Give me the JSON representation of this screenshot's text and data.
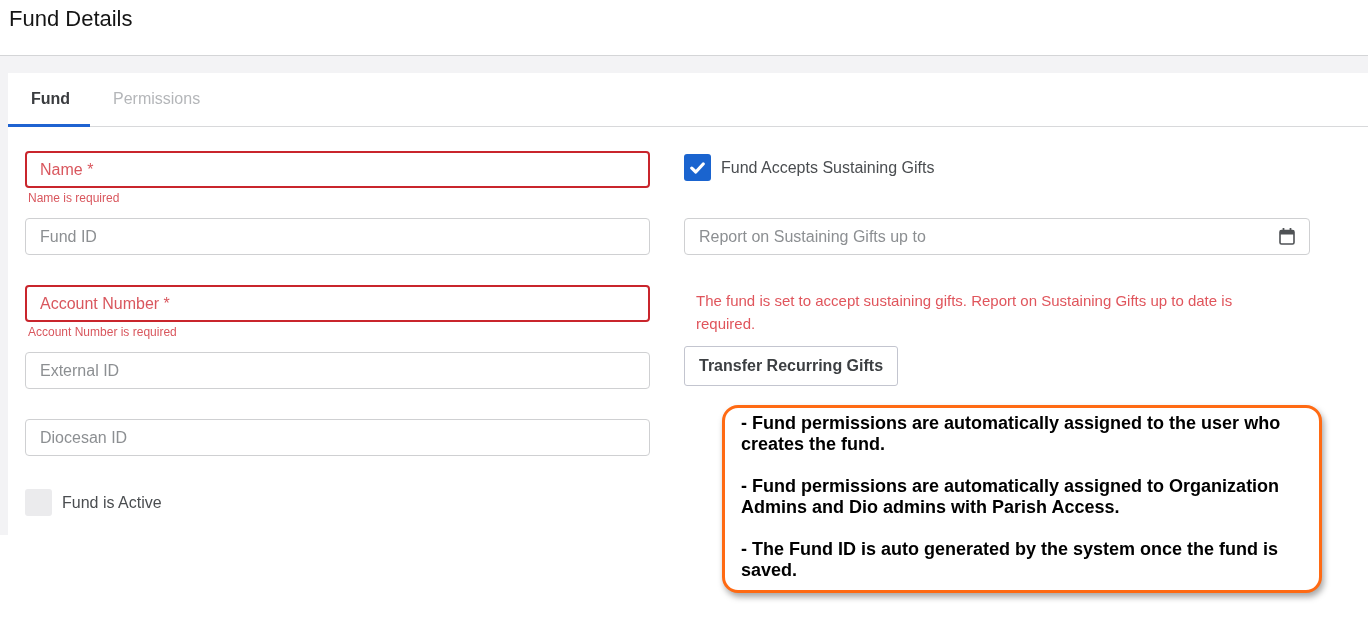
{
  "page": {
    "title": "Fund Details"
  },
  "tabs": [
    {
      "label": "Fund",
      "selected": true
    },
    {
      "label": "Permissions",
      "selected": false
    }
  ],
  "left_fields": [
    {
      "kind": "text",
      "placeholder": "Name *",
      "invalid": true,
      "error": "Name is required"
    },
    {
      "kind": "text",
      "placeholder": "Fund ID",
      "invalid": false
    },
    {
      "kind": "text",
      "placeholder": "Account Number *",
      "invalid": true,
      "error": "Account Number is required"
    },
    {
      "kind": "text",
      "placeholder": "External ID",
      "invalid": false
    },
    {
      "kind": "text",
      "placeholder": "Diocesan ID",
      "invalid": false
    },
    {
      "kind": "checkbox",
      "label": "Fund is Active",
      "checked": false
    }
  ],
  "right_fields": [
    {
      "kind": "checkbox",
      "label": "Fund Accepts Sustaining Gifts",
      "checked": true
    },
    {
      "kind": "date",
      "placeholder": "Report on Sustaining Gifts up to"
    },
    {
      "kind": "error",
      "text": "The fund is set to accept sustaining gifts. Report on Sustaining Gifts up to date is required."
    },
    {
      "kind": "button",
      "label": "Transfer Recurring Gifts"
    }
  ],
  "callout": {
    "paragraphs": [
      "- Fund permissions are automatically assigned to the user who creates the fund.",
      "- Fund permissions are automatically assigned to Organization Admins and Dio admins with Parish Access.",
      "- The Fund ID is auto generated by the system once the fund is saved."
    ]
  }
}
